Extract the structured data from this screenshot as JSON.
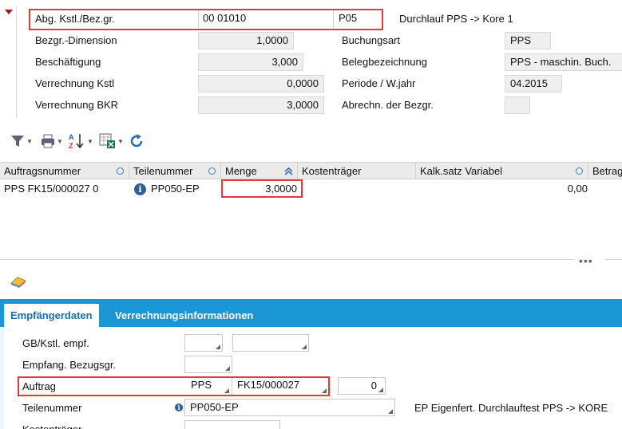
{
  "header": {
    "abg_label": "Abg. Kstl./Bez.gr.",
    "abg_value1": "00 01010",
    "abg_value2": "P05",
    "durchlauf_text": "Durchlauf PPS -> Kore 1",
    "bezgr_dim_label": "Bezgr.-Dimension",
    "bezgr_dim_value": "1,0000",
    "beschaeftigung_label": "Beschäftigung",
    "beschaeftigung_value": "3,000",
    "verr_kstl_label": "Verrechnung Kstl",
    "verr_kstl_value": "0,0000",
    "verr_bkr_label": "Verrechnung BKR",
    "verr_bkr_value": "3,0000",
    "buchungsart_label": "Buchungsart",
    "buchungsart_value": "PPS",
    "belegbez_label": "Belegbezeichnung",
    "belegbez_value": "PPS - maschin. Buch.",
    "periode_label": "Periode / W.jahr",
    "periode_value": "04.2015",
    "abrechn_label": "Abrechn. der Bezgr.",
    "abrechn_value": ""
  },
  "toolbar": {
    "icons": [
      "filter-icon",
      "print-icon",
      "sort-az-icon",
      "excel-export-icon",
      "refresh-icon"
    ]
  },
  "grid": {
    "columns": [
      "Auftragsnummer",
      "Teilenummer",
      "Menge",
      "Kostenträger",
      "Kalk.satz Variabel",
      "Betrag"
    ],
    "rows": [
      {
        "auftragsnummer": "PPS FK15/000027 0",
        "teilenummer": "PP050-EP",
        "menge": "3,0000",
        "kostentraeger": "",
        "kalk_satz": "0,00",
        "betrag": ""
      }
    ]
  },
  "tabs": {
    "active": "Empfängerdaten",
    "inactive": "Verrechnungsinformationen"
  },
  "detail": {
    "gb_kstl_label": "GB/Kstl. empf.",
    "empfang_label": "Empfang. Bezugsgr.",
    "auftrag_label": "Auftrag",
    "auftrag_type": "PPS",
    "auftrag_number": "FK15/000027",
    "auftrag_pos": "0",
    "teilenummer_label": "Teilenummer",
    "teilenummer_value": "PP050-EP",
    "teilenummer_desc": "EP Eigenfert. Durchlauftest PPS -> KORE",
    "kostentraeger_label": "Kostenträger"
  },
  "colors": {
    "accent": "#1a96d4",
    "highlight": "#e03a3e"
  }
}
